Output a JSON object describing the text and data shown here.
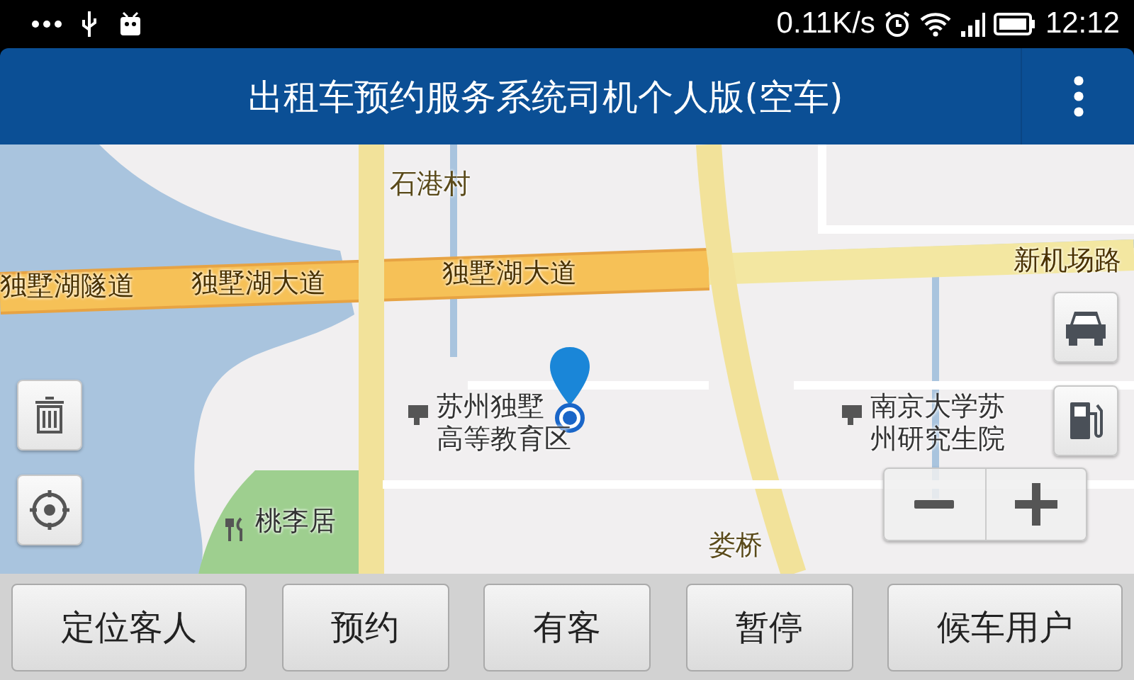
{
  "status_bar": {
    "speed": "0.11K/s",
    "time": "12:12"
  },
  "title_bar": {
    "title": "出租车预约服务系统司机个人版(空车)"
  },
  "map": {
    "labels": [
      {
        "text": "石港村",
        "kind": "place"
      },
      {
        "text": "独墅湖隧道",
        "kind": "road"
      },
      {
        "text": "独墅湖大道",
        "kind": "road"
      },
      {
        "text": "独墅湖大道",
        "kind": "road"
      },
      {
        "text": "新机场路",
        "kind": "road"
      },
      {
        "text": "苏州独墅",
        "kind": "poi"
      },
      {
        "text": "高等教育区",
        "kind": "poi-line"
      },
      {
        "text": "南京大学苏",
        "kind": "poi"
      },
      {
        "text": "州研究生院",
        "kind": "poi-line"
      },
      {
        "text": "桃李居",
        "kind": "food"
      },
      {
        "text": "娄桥",
        "kind": "place"
      }
    ]
  },
  "buttons": [
    {
      "label": "定位客人"
    },
    {
      "label": "预约"
    },
    {
      "label": "有客"
    },
    {
      "label": "暂停"
    },
    {
      "label": "候车用户"
    }
  ]
}
